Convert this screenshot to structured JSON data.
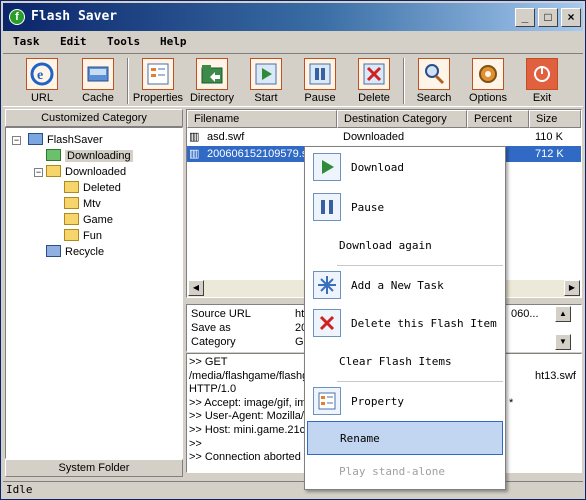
{
  "window": {
    "title": "Flash Saver",
    "controls": {
      "minimize": "_",
      "maximize": "□",
      "close": "×"
    }
  },
  "menu": [
    "Task",
    "Edit",
    "Tools",
    "Help"
  ],
  "toolbar": [
    {
      "label": "URL",
      "icon": "url-icon"
    },
    {
      "label": "Cache",
      "icon": "cache-icon"
    },
    {
      "label": "Properties",
      "icon": "properties-icon"
    },
    {
      "label": "Directory",
      "icon": "directory-icon"
    },
    {
      "label": "Start",
      "icon": "start-icon"
    },
    {
      "label": "Pause",
      "icon": "pause-icon"
    },
    {
      "label": "Delete",
      "icon": "delete-icon"
    },
    {
      "label": "Search",
      "icon": "search-icon"
    },
    {
      "label": "Options",
      "icon": "options-icon"
    },
    {
      "label": "Exit",
      "icon": "exit-icon"
    }
  ],
  "left_panel": {
    "header": "Customized Category",
    "footer": "System Folder",
    "tree": {
      "root": "FlashSaver",
      "downloading": "Downloading",
      "downloaded": "Downloaded",
      "children": [
        "Deleted",
        "Mtv",
        "Game",
        "Fun"
      ],
      "recycle": "Recycle"
    }
  },
  "file_list": {
    "columns": [
      "Filename",
      "Destination Category",
      "Percent",
      "Size"
    ],
    "rows": [
      {
        "filename": "asd.swf",
        "category": "Downloaded",
        "percent": "",
        "size": "110 K"
      },
      {
        "filename": "200606152109579.s",
        "category": "",
        "percent": "",
        "size": "712 K"
      }
    ]
  },
  "details": [
    {
      "label": "Source URL",
      "value": "ht",
      "tail": "060..."
    },
    {
      "label": "Save as",
      "value": "20"
    },
    {
      "label": "Category",
      "value": "Ga"
    }
  ],
  "log_lines": [
    {
      "left": ">> GET",
      "right": ""
    },
    {
      "left": "/media/flashgame/flashg",
      "right": "ht13.swf"
    },
    {
      "left": "HTTP/1.0",
      "right": ""
    },
    {
      "left": ">> Accept: image/gif, ima",
      "right": "*"
    },
    {
      "left": ">> User-Agent: Mozilla/3",
      "right": ""
    },
    {
      "left": ">> Host: mini.game.21cn",
      "right": ""
    },
    {
      "left": ">>",
      "right": ""
    },
    {
      "left": ">> Connection aborted o",
      "right": ""
    }
  ],
  "status": "Idle",
  "context_menu": {
    "items": [
      {
        "label": "Download",
        "icon": "download-icon",
        "state": "normal"
      },
      {
        "label": "Pause",
        "icon": "pause-icon",
        "state": "normal"
      },
      {
        "label": "Download again",
        "icon": "",
        "state": "normal"
      },
      {
        "label": "Add a New Task",
        "icon": "add-task-icon",
        "state": "normal"
      },
      {
        "label": "Delete this Flash Item",
        "icon": "delete-item-icon",
        "state": "normal"
      },
      {
        "label": "Clear Flash Items",
        "icon": "",
        "state": "normal"
      },
      {
        "label": "Property",
        "icon": "property-icon",
        "state": "normal"
      },
      {
        "label": "Rename",
        "icon": "",
        "state": "hover"
      },
      {
        "label": "Play stand-alone",
        "icon": "",
        "state": "disabled"
      }
    ]
  },
  "colors": {
    "selection": "#316ac5",
    "menu_hover": "#c2d6f2",
    "title_start": "#0a246a",
    "title_end": "#a6caf0"
  }
}
